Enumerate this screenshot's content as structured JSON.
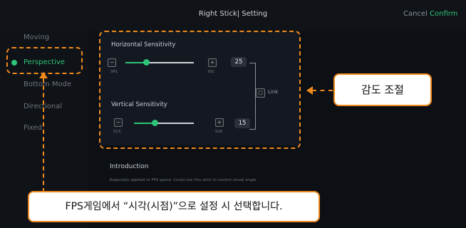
{
  "header": {
    "title": "Right Stick| Setting",
    "cancel_label": "Cancel",
    "confirm_label": "Confirm"
  },
  "sidebar": {
    "items": [
      {
        "label": "Moving",
        "active": false
      },
      {
        "label": "Perspective",
        "active": true
      },
      {
        "label": "Bottom Mode",
        "active": false
      },
      {
        "label": "Directional",
        "active": false
      },
      {
        "label": "Fixed",
        "active": false
      }
    ]
  },
  "panel": {
    "horizontal": {
      "label": "Horizontal Sensitivity",
      "value": "25",
      "min_label": "SML",
      "max_label": "BIG",
      "level": 0.3
    },
    "vertical": {
      "label": "Vertical Sensitivity",
      "value": "15",
      "min_label": "QCK",
      "max_label": "SLW",
      "level": 0.35
    },
    "link_label": "Link",
    "minus": "−",
    "plus": "+"
  },
  "intro": {
    "heading": "Introduction",
    "text": "Especially applied to FPS game. Could use this stick to control visual angle"
  },
  "annotations": {
    "sensitivity_callout": "감도 조절",
    "fps_callout": "FPS게임에서 “시각(시점)”으로 설정 시 선택합니다."
  },
  "colors": {
    "accent": "#2ec47a",
    "annotation": "#f08a1e",
    "background": "#0c0f14"
  }
}
